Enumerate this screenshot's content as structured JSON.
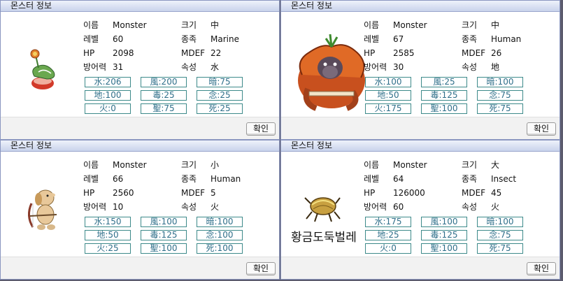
{
  "panels": [
    {
      "title": "몬스터 정보",
      "monster_name": "",
      "labels": {
        "name": "이름",
        "level": "레벨",
        "hp": "HP",
        "def": "방어력",
        "size": "크기",
        "race": "종족",
        "mdef": "MDEF",
        "element": "속성"
      },
      "name": "Monster",
      "level": "60",
      "hp": "2098",
      "def": "31",
      "size": "中",
      "race": "Marine",
      "mdef": "22",
      "element": "水",
      "cells": [
        "水:206",
        "風:200",
        "暗:75",
        "地:100",
        "毒:25",
        "念:25",
        "火:0",
        "聖:75",
        "死:25"
      ],
      "ok_label": "확인"
    },
    {
      "title": "몬스터 정보",
      "monster_name": "",
      "labels": {
        "name": "이름",
        "level": "레벨",
        "hp": "HP",
        "def": "방어력",
        "size": "크기",
        "race": "종족",
        "mdef": "MDEF",
        "element": "속성"
      },
      "name": "Monster",
      "level": "67",
      "hp": "2585",
      "def": "30",
      "size": "中",
      "race": "Human",
      "mdef": "26",
      "element": "地",
      "cells": [
        "水:100",
        "風:25",
        "暗:100",
        "地:50",
        "毒:125",
        "念:75",
        "火:175",
        "聖:100",
        "死:75"
      ],
      "ok_label": "확인"
    },
    {
      "title": "몬스터 정보",
      "monster_name": "",
      "labels": {
        "name": "이름",
        "level": "레벨",
        "hp": "HP",
        "def": "방어력",
        "size": "크기",
        "race": "종족",
        "mdef": "MDEF",
        "element": "속성"
      },
      "name": "Monster",
      "level": "66",
      "hp": "2560",
      "def": "10",
      "size": "小",
      "race": "Human",
      "mdef": "5",
      "element": "火",
      "cells": [
        "水:150",
        "風:100",
        "暗:100",
        "地:50",
        "毒:125",
        "念:100",
        "火:25",
        "聖:100",
        "死:100"
      ],
      "ok_label": "확인"
    },
    {
      "title": "몬스터 정보",
      "monster_name": "황금도둑벌레",
      "labels": {
        "name": "이름",
        "level": "레벨",
        "hp": "HP",
        "def": "방어력",
        "size": "크기",
        "race": "종족",
        "mdef": "MDEF",
        "element": "속성"
      },
      "name": "Monster",
      "level": "64",
      "hp": "126000",
      "def": "60",
      "size": "大",
      "race": "Insect",
      "mdef": "45",
      "element": "火",
      "cells": [
        "水:175",
        "風:100",
        "暗:100",
        "地:25",
        "毒:125",
        "念:75",
        "火:0",
        "聖:100",
        "死:75"
      ],
      "ok_label": "확인"
    }
  ],
  "icons": [
    "venus-flytrap-monster-icon",
    "orangutan-monster-icon",
    "dog-archer-monster-icon",
    "golden-thief-bug-icon"
  ]
}
